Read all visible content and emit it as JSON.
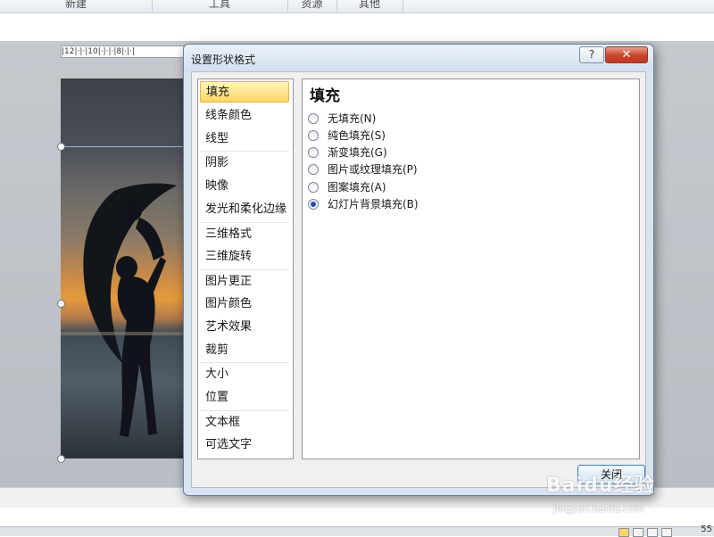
{
  "ribbon": {
    "groups": [
      "新建",
      "工具",
      "资源",
      "其他"
    ]
  },
  "ruler": {
    "text": "|12|·|·|10|·|·|·|8|·|·|"
  },
  "dialog": {
    "title": "设置形状格式",
    "help_label": "?",
    "close_label": "✕",
    "categories": [
      "填充",
      "线条颜色",
      "线型",
      "阴影",
      "映像",
      "发光和柔化边缘",
      "三维格式",
      "三维旋转",
      "图片更正",
      "图片颜色",
      "艺术效果",
      "裁剪",
      "大小",
      "位置",
      "文本框",
      "可选文字"
    ],
    "selected_category": "填充",
    "panel": {
      "title": "填充",
      "options": [
        {
          "label": "无填充(N)",
          "checked": false
        },
        {
          "label": "纯色填充(S)",
          "checked": false
        },
        {
          "label": "渐变填充(G)",
          "checked": false
        },
        {
          "label": "图片或纹理填充(P)",
          "checked": false
        },
        {
          "label": "图案填充(A)",
          "checked": false
        },
        {
          "label": "幻灯片背景填充(B)",
          "checked": true
        }
      ]
    },
    "close_button": "关闭"
  },
  "status": {
    "zoom": "55"
  },
  "watermark": {
    "text": "Baidu经验",
    "url": "jingyan.baidu.com"
  },
  "colors": {
    "accent": "#ffd761",
    "close": "#c8432a",
    "radio": "#1f4fb5"
  }
}
